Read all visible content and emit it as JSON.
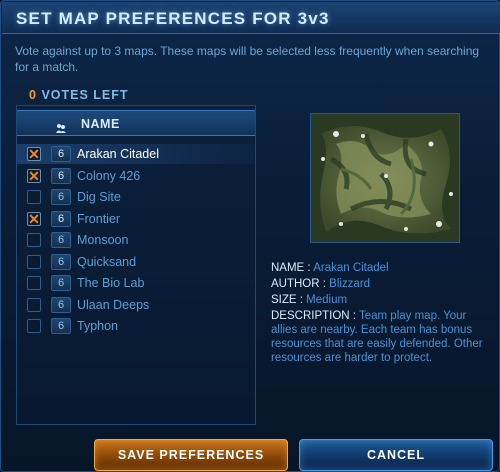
{
  "dialog": {
    "title": "SET MAP PREFERENCES FOR 3v3",
    "description": "Vote against up to 3 maps. These maps will be selected less frequently when searching for a match.",
    "votes_left_count": "0",
    "votes_left_label": "VOTES LEFT"
  },
  "list": {
    "header_label": "NAME",
    "header_icon": "players-icon",
    "rows": [
      {
        "name": "Arakan Citadel",
        "players": "6",
        "vetoed": true,
        "selected": true
      },
      {
        "name": "Colony 426",
        "players": "6",
        "vetoed": true,
        "selected": false
      },
      {
        "name": "Dig Site",
        "players": "6",
        "vetoed": false,
        "selected": false
      },
      {
        "name": "Frontier",
        "players": "6",
        "vetoed": true,
        "selected": false
      },
      {
        "name": "Monsoon",
        "players": "6",
        "vetoed": false,
        "selected": false
      },
      {
        "name": "Quicksand",
        "players": "6",
        "vetoed": false,
        "selected": false
      },
      {
        "name": "The Bio Lab",
        "players": "6",
        "vetoed": false,
        "selected": false
      },
      {
        "name": "Ulaan Deeps",
        "players": "6",
        "vetoed": false,
        "selected": false
      },
      {
        "name": "Typhon",
        "players": "6",
        "vetoed": false,
        "selected": false
      }
    ]
  },
  "details": {
    "name_label": "NAME :",
    "name_value": "Arakan Citadel",
    "author_label": "AUTHOR :",
    "author_value": "Blizzard",
    "size_label": "SIZE :",
    "size_value": "Medium",
    "description_label": "DESCRIPTION :",
    "description_value": "Team play map. Your allies are nearby. Each team has bonus resources that are easily defended. Other resources are harder to protect."
  },
  "buttons": {
    "save_label": "SAVE PREFERENCES",
    "cancel_label": "CANCEL"
  },
  "colors": {
    "accent_orange": "#f29c2b",
    "veto_x": "#f08a1c",
    "value_blue": "#4b91d6",
    "title_white": "#d7ecff"
  }
}
